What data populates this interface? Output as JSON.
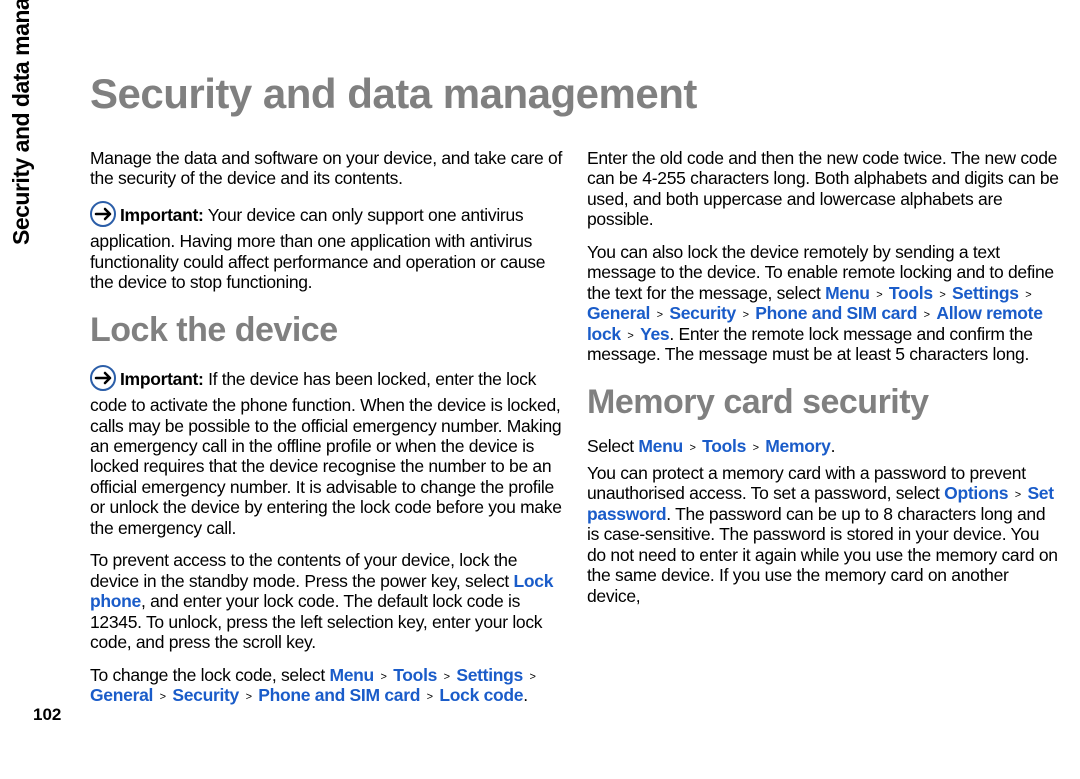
{
  "side_label": "Security and data management",
  "page_number": "102",
  "title": "Security and data management",
  "h2_lock": "Lock the device",
  "h2_memory": "Memory card security",
  "p_intro": "Manage the data and software on your device, and take care of the security of the device and its contents.",
  "imp1_label": "Important:",
  "imp1_body": "  Your device can only support one antivirus application. Having more than one application with antivirus functionality could affect performance and operation or cause the device to stop functioning.",
  "imp2_label": "Important:",
  "imp2_body": " If the device has been locked, enter the lock code to activate the phone function. When the device is locked, calls may be possible to the official emergency number. Making an emergency call in the offline profile or when the device is locked requires that the device recognise the number to be an official emergency number. It is advisable to change the profile or unlock the device by entering the lock code before you make the emergency call.",
  "p_lock1_a": "To prevent access to the contents of your device, lock the device in the standby mode. Press the power key, select ",
  "link_lock_phone": "Lock phone",
  "p_lock1_b": ", and enter your lock code. The default lock code is 12345. To unlock, press the left selection key, enter your lock code, and press the scroll key.",
  "p_lock2_a": "To change the lock code, select ",
  "nav_menu": "Menu",
  "nav_tools": "Tools",
  "nav_settings": "Settings",
  "nav_general": "General",
  "nav_security": "Security",
  "nav_phone_sim": "Phone and SIM card",
  "nav_lock_code": "Lock code",
  "p_lock2_b": ". Enter the old code and then the new code twice. The new code can be 4-255 characters long. Both alphabets and digits can be used, and both uppercase and lowercase alphabets are possible.",
  "p_lock3_a": "You can also lock the device remotely by sending a text message to the device. To enable remote locking and to define the text for the message, select ",
  "nav_allow_remote": "Allow remote lock",
  "nav_yes": "Yes",
  "p_lock3_b": ". Enter the remote lock message and confirm the message. The message must be at least 5 characters long.",
  "p_mem_path_a": "Select ",
  "nav_memory": "Memory",
  "p_mem_path_b": ".",
  "p_mem2_a": "You can protect a memory card with a password to prevent unauthorised access. To set a password, select ",
  "nav_options": "Options",
  "nav_set_password": "Set password",
  "p_mem2_b": ". The password can be up to 8 characters long and is case-sensitive. The password is stored in your device. You do not need to enter it again while you use the memory card on the same device. If you use the memory card on another device,"
}
